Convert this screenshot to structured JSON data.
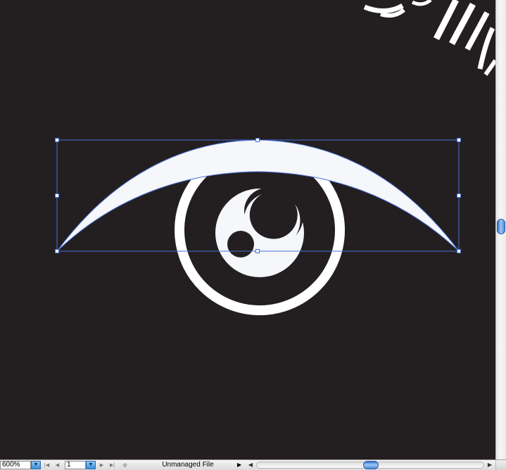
{
  "colors": {
    "canvas_background": "#231f20",
    "artwork_fill": "#f5f7fb",
    "selection_color": "#4a6fd8",
    "scrollbar_accent": "#3d8fdc"
  },
  "statusbar": {
    "zoom_value": "600%",
    "page_number": "1",
    "file_status": "Unmanaged File",
    "icons": {
      "zoom_dropdown": "chevron-down-icon",
      "first_page": "first-page-icon",
      "prev_page": "prev-page-icon",
      "page_dropdown": "chevron-down-icon",
      "next_page": "next-page-icon",
      "last_page": "last-page-icon",
      "version_cue": "version-cue-icon",
      "status_menu": "triangle-right-icon"
    }
  },
  "canvas": {
    "selected_object": "eyelid-crescent",
    "selection_handles": 8
  },
  "scrollbars": {
    "vertical_position": 0.49,
    "horizontal_position": 0.5
  }
}
